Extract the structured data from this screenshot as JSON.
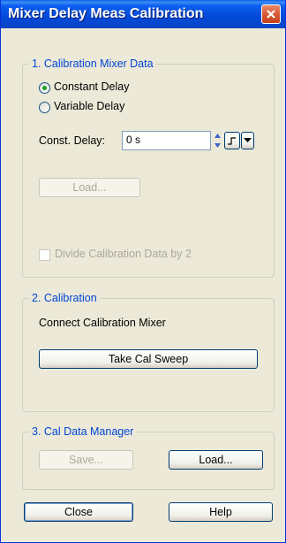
{
  "window": {
    "title": "Mixer Delay Meas Calibration"
  },
  "group1": {
    "legend": "1. Calibration Mixer Data",
    "radio_constant": "Constant Delay",
    "radio_variable": "Variable Delay",
    "const_delay_label": "Const. Delay:",
    "const_delay_value": "0 s",
    "load_button": "Load...",
    "divide_checkbox": "Divide Calibration Data by 2",
    "selected_option": "Constant Delay"
  },
  "group2": {
    "legend": "2. Calibration",
    "instruction": "Connect Calibration Mixer",
    "take_cal_button": "Take Cal Sweep"
  },
  "group3": {
    "legend": "3. Cal Data Manager",
    "save_button": "Save...",
    "load_button": "Load..."
  },
  "footer": {
    "close_button": "Close",
    "help_button": "Help"
  },
  "colors": {
    "title_bar": "#0349d8",
    "legend_text": "#0046d5",
    "dialog_bg": "#ece9d8",
    "close_red": "#d85a36"
  },
  "icons": [
    "close-icon",
    "spinner-up-icon",
    "spinner-down-icon",
    "step-icon",
    "dropdown-arrow-icon"
  ]
}
